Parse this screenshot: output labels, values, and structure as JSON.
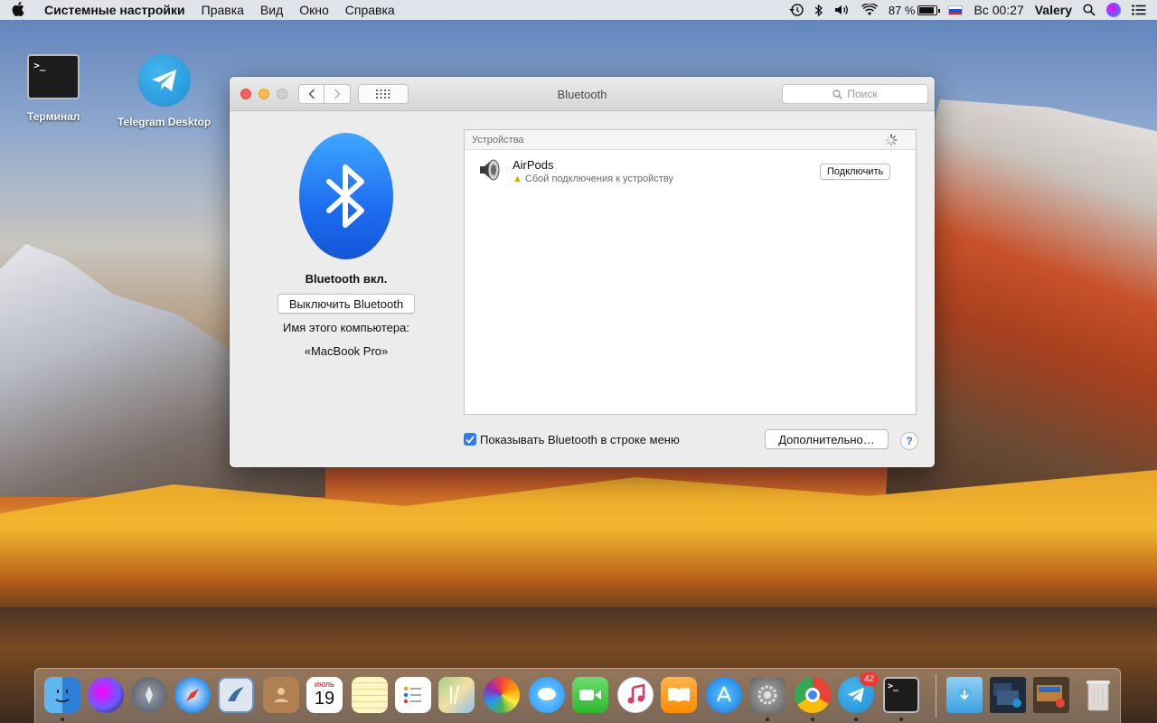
{
  "menubar": {
    "app_name": "Системные настройки",
    "menus": [
      "Правка",
      "Вид",
      "Окно",
      "Справка"
    ],
    "battery_percent": "87 %",
    "battery_level": 0.87,
    "clock": "Вс 00:27",
    "user": "Valery"
  },
  "desktop": {
    "icons": [
      {
        "label": "Терминал",
        "icon": "terminal-icon"
      },
      {
        "label": "Telegram Desktop",
        "icon": "telegram-icon"
      }
    ],
    "terminal_prompt": ">_"
  },
  "window": {
    "title": "Bluetooth",
    "search_placeholder": "Поиск",
    "left": {
      "status": "Bluetooth вкл.",
      "toggle_button": "Выключить Bluetooth",
      "computer_name_label": "Имя этого компьютера:",
      "computer_name": "«MacBook Pro»"
    },
    "devices": {
      "header": "Устройства",
      "items": [
        {
          "name": "AirPods",
          "status": "Сбой подключения к устройству",
          "action": "Подключить"
        }
      ]
    },
    "show_in_menubar_label": "Показывать Bluetooth в строке меню",
    "show_in_menubar_checked": true,
    "advanced_button": "Дополнительно…",
    "help_button": "?"
  },
  "dock": {
    "calendar_month": "ИЮЛЬ",
    "calendar_day": "19",
    "telegram_badge": "42",
    "apps": [
      "finder",
      "siri",
      "launchpad",
      "safari",
      "mail",
      "contacts",
      "calendar",
      "notes",
      "reminders",
      "maps",
      "photos",
      "messages",
      "facetime",
      "itunes",
      "ibooks",
      "app-store",
      "system-preferences",
      "chrome",
      "telegram",
      "terminal",
      "downloads",
      "desktop-stack",
      "desktop-stack-2",
      "trash"
    ]
  },
  "colors": {
    "bluetooth_blue": "#1c6cf0",
    "checkbox_blue": "#2f7df6",
    "close_red": "#fc605c",
    "minimize_yellow": "#fdbc40",
    "warning_yellow": "#e2a200"
  }
}
